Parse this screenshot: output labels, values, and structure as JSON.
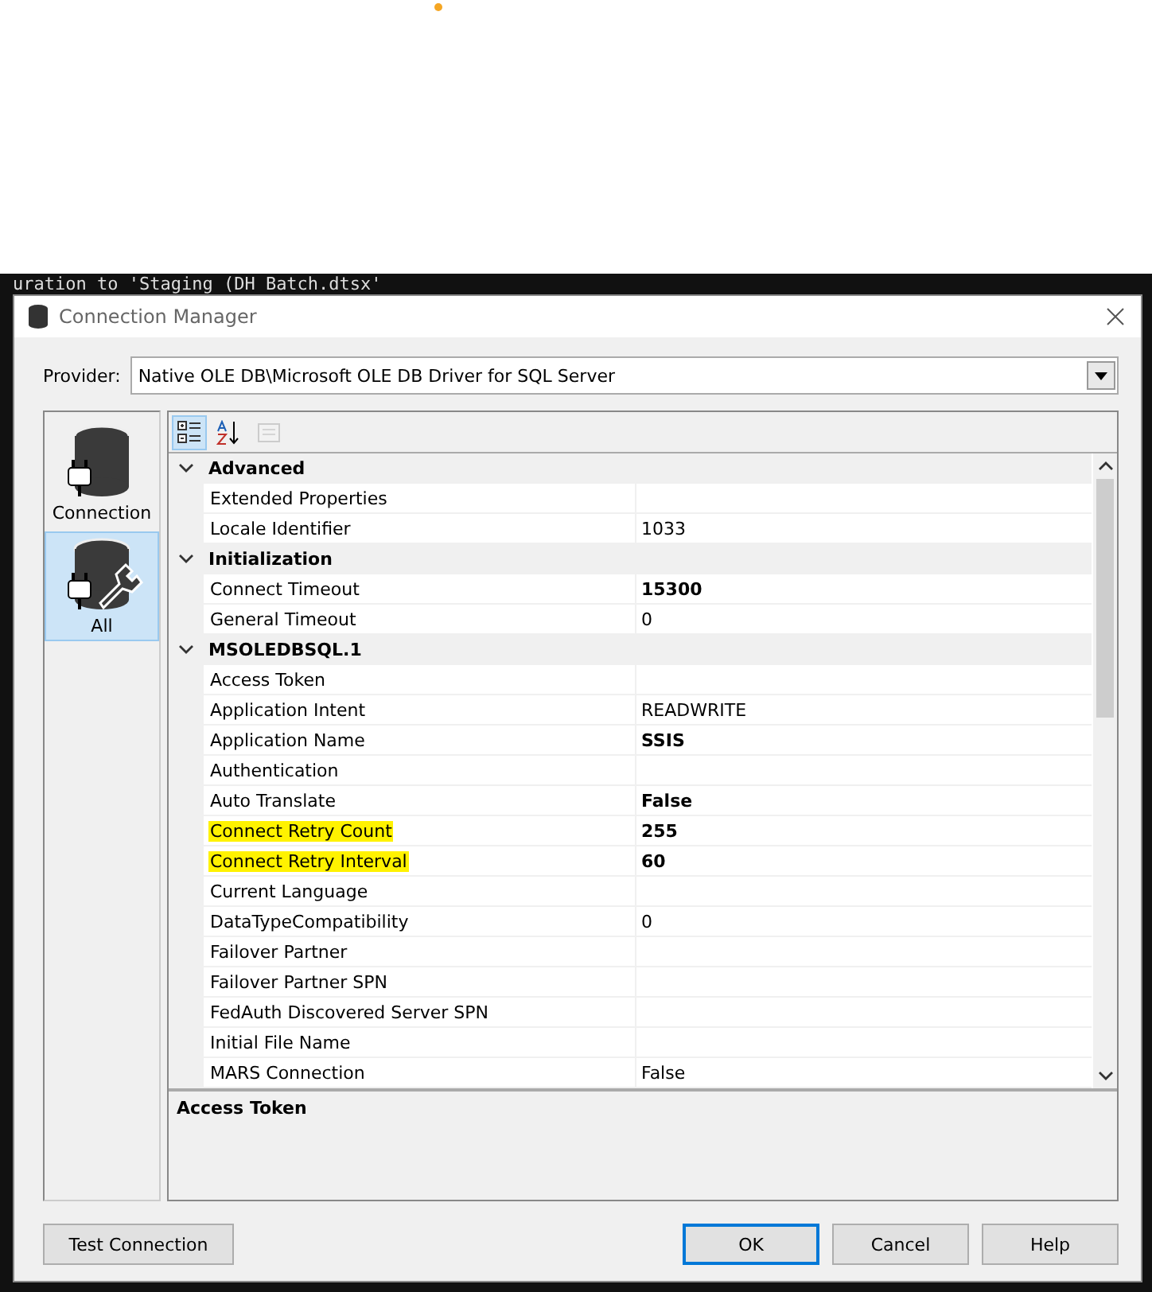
{
  "background": {
    "code_line": "uration to 'Staging (DH Batch.dtsx'"
  },
  "window": {
    "title": "Connection Manager"
  },
  "provider": {
    "label": "Provider:",
    "value": "Native OLE DB\\Microsoft OLE DB Driver for SQL Server"
  },
  "pages": [
    {
      "label": "Connection",
      "kind": "connection",
      "selected": false
    },
    {
      "label": "All",
      "kind": "all",
      "selected": true
    }
  ],
  "toolbar": [
    {
      "kind": "categorized",
      "selected": true,
      "disabled": false
    },
    {
      "kind": "alphabetical",
      "selected": false,
      "disabled": false
    },
    {
      "kind": "property-pages",
      "selected": false,
      "disabled": true
    }
  ],
  "rows": [
    {
      "kind": "category",
      "name": "Advanced",
      "expanded": true
    },
    {
      "kind": "property",
      "name": "Extended Properties",
      "value": "",
      "highlighted": false
    },
    {
      "kind": "property",
      "name": "Locale Identifier",
      "value": "1033",
      "bold": false,
      "highlighted": false
    },
    {
      "kind": "category",
      "name": "Initialization",
      "expanded": true
    },
    {
      "kind": "property",
      "name": "Connect Timeout",
      "value": "15300",
      "bold": true,
      "highlighted": false
    },
    {
      "kind": "property",
      "name": "General Timeout",
      "value": "0",
      "bold": false,
      "highlighted": false
    },
    {
      "kind": "category",
      "name": "MSOLEDBSQL.1",
      "expanded": true
    },
    {
      "kind": "property",
      "name": "Access Token",
      "value": "",
      "highlighted": false
    },
    {
      "kind": "property",
      "name": "Application Intent",
      "value": "READWRITE",
      "bold": false,
      "highlighted": false
    },
    {
      "kind": "property",
      "name": "Application Name",
      "value": "SSIS",
      "bold": true,
      "highlighted": false
    },
    {
      "kind": "property",
      "name": "Authentication",
      "value": "",
      "highlighted": false
    },
    {
      "kind": "property",
      "name": "Auto Translate",
      "value": "False",
      "bold": true,
      "highlighted": false
    },
    {
      "kind": "property",
      "name": "Connect Retry Count",
      "value": "255",
      "bold": true,
      "highlighted": true
    },
    {
      "kind": "property",
      "name": "Connect Retry Interval",
      "value": "60",
      "bold": true,
      "highlighted": true
    },
    {
      "kind": "property",
      "name": "Current Language",
      "value": "",
      "highlighted": false
    },
    {
      "kind": "property",
      "name": "DataTypeCompatibility",
      "value": "0",
      "bold": false,
      "highlighted": false
    },
    {
      "kind": "property",
      "name": "Failover Partner",
      "value": "",
      "highlighted": false
    },
    {
      "kind": "property",
      "name": "Failover Partner SPN",
      "value": "",
      "highlighted": false
    },
    {
      "kind": "property",
      "name": "FedAuth Discovered Server SPN",
      "value": "",
      "highlighted": false
    },
    {
      "kind": "property",
      "name": "Initial File Name",
      "value": "",
      "highlighted": false
    },
    {
      "kind": "property",
      "name": "MARS Connection",
      "value": "False",
      "bold": false,
      "highlighted": false
    }
  ],
  "description": {
    "title": "Access Token"
  },
  "buttons": [
    {
      "label": "Test Connection",
      "default": false
    },
    {
      "label": "OK",
      "default": true
    },
    {
      "label": "Cancel",
      "default": false
    },
    {
      "label": "Help",
      "default": false
    }
  ]
}
